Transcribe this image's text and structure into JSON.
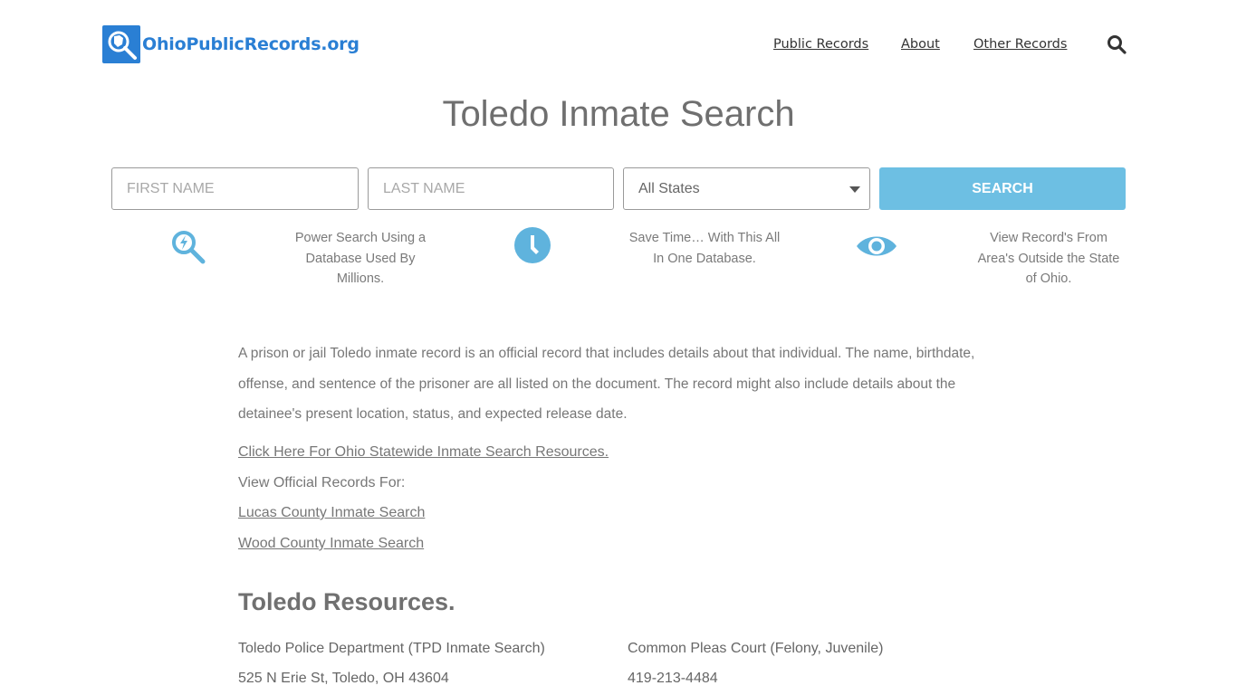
{
  "header": {
    "logo_text": "OhioPublicRecords.org",
    "nav": [
      {
        "label": "Public Records"
      },
      {
        "label": "About"
      },
      {
        "label": "Other Records"
      }
    ]
  },
  "page_title": "Toledo Inmate Search",
  "form": {
    "first_name_placeholder": "FIRST NAME",
    "last_name_placeholder": "LAST NAME",
    "state_selected": "All States",
    "search_label": "SEARCH"
  },
  "features": [
    {
      "icon": "power-search-icon",
      "text": "Power Search Using a Database Used By Millions."
    },
    {
      "icon": "clock-icon",
      "text": "Save Time… With This All In One Database."
    },
    {
      "icon": "eye-icon",
      "text": "View Record's From Area's Outside the State of Ohio."
    }
  ],
  "intro_paragraph": "A prison or jail Toledo inmate record is an official record that includes details about that individual. The name, birthdate, offense, and sentence of the prisoner are all listed on the document. The record might also include details about the detainee's present location, status, and expected release date.",
  "statewide_link": "Click Here For Ohio Statewide Inmate Search Resources.",
  "view_official_label": "View Official Records For:",
  "county_links": [
    "Lucas County Inmate Search",
    "Wood County Inmate Search"
  ],
  "resources": {
    "title": "Toledo Resources.",
    "items": [
      {
        "name": "Toledo Police Department (TPD Inmate Search)",
        "detail": "525 N Erie St, Toledo, OH 43604"
      },
      {
        "name": "Common Pleas Court (Felony, Juvenile)",
        "detail": "419-213-4484"
      }
    ]
  },
  "colors": {
    "brand": "#2a7fd4",
    "accent": "#6dbfe3",
    "link": "#2a7fc9"
  }
}
